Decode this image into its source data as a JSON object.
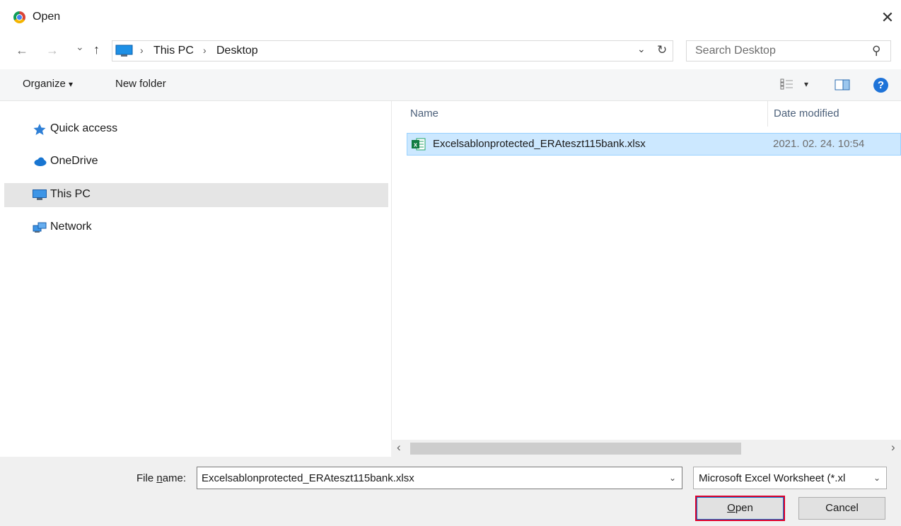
{
  "window": {
    "title": "Open",
    "close_glyph": "✕"
  },
  "address": {
    "back_glyph": "←",
    "forward_glyph": "→",
    "recent_glyph": "⌄",
    "up_glyph": "↑",
    "crumb_sep": "›",
    "breadcrumbs": [
      "This PC",
      "Desktop"
    ],
    "dropdown_glyph": "⌄",
    "refresh_glyph": "↻",
    "search_placeholder": "Search Desktop",
    "search_glyph": "⚲"
  },
  "toolbar": {
    "organize_label": "Organize",
    "organize_caret": "▾",
    "new_folder_label": "New folder",
    "views_caret": "▾",
    "help_glyph": "?"
  },
  "navigation": {
    "items": [
      {
        "label": "Quick access",
        "icon": "star-icon",
        "selected": false
      },
      {
        "label": "OneDrive",
        "icon": "cloud-icon",
        "selected": false
      },
      {
        "label": "This PC",
        "icon": "monitor-icon",
        "selected": true
      },
      {
        "label": "Network",
        "icon": "network-icon",
        "selected": false
      }
    ]
  },
  "file_list": {
    "columns": [
      "Name",
      "Date modified"
    ],
    "files": [
      {
        "name": "Excelsablonprotected_ERAteszt115bank.xlsx",
        "date": "2021. 02. 24. 10:54",
        "icon": "excel-file-icon",
        "selected": true
      }
    ],
    "scroll_left": "‹",
    "scroll_right": "›"
  },
  "footer": {
    "file_name_label_pre": "File ",
    "file_name_label_u": "n",
    "file_name_label_post": "ame:",
    "file_name_value": "Excelsablonprotected_ERAteszt115bank.xlsx",
    "file_name_chevron": "⌄",
    "file_type_value": "Microsoft Excel Worksheet (*.xl",
    "file_type_chevron": "⌄",
    "open_label_u": "O",
    "open_label_rest": "pen",
    "cancel_label": "Cancel"
  },
  "colors": {
    "highlight": "#cce8ff",
    "open_outline": "#e0002a",
    "accent": "#0078d7"
  }
}
